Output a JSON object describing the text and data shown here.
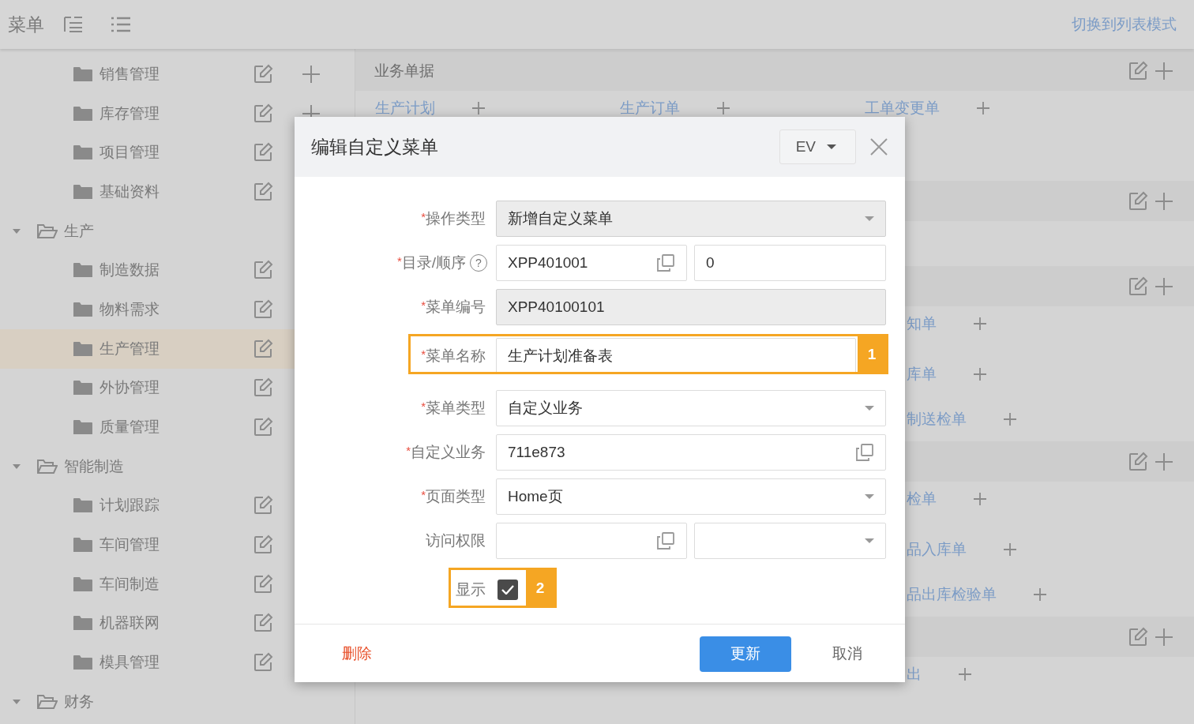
{
  "header": {
    "title": "菜单",
    "switch_link": "切换到列表模式"
  },
  "sidebar": {
    "items_above": [
      {
        "label": "销售管理",
        "selected": false,
        "add_button": true
      },
      {
        "label": "库存管理",
        "selected": false,
        "add_button": true
      },
      {
        "label": "项目管理",
        "selected": false,
        "add_button": false
      },
      {
        "label": "基础资料",
        "selected": false,
        "add_button": false
      }
    ],
    "groups": [
      {
        "label": "生产",
        "expanded": true,
        "children": [
          {
            "label": "制造数据",
            "selected": false,
            "add_button": false
          },
          {
            "label": "物料需求",
            "selected": false,
            "add_button": false
          },
          {
            "label": "生产管理",
            "selected": true,
            "add_button": false
          },
          {
            "label": "外协管理",
            "selected": false,
            "add_button": false
          },
          {
            "label": "质量管理",
            "selected": false,
            "add_button": false
          }
        ]
      },
      {
        "label": "智能制造",
        "expanded": true,
        "children": [
          {
            "label": "计划跟踪",
            "selected": false,
            "add_button": false
          },
          {
            "label": "车间管理",
            "selected": false,
            "add_button": false
          },
          {
            "label": "车间制造",
            "selected": false,
            "add_button": false
          },
          {
            "label": "机器联网",
            "selected": false,
            "add_button": false
          },
          {
            "label": "模具管理",
            "selected": false,
            "add_button": false
          }
        ]
      },
      {
        "label": "财务",
        "expanded": true
      }
    ]
  },
  "sections": [
    {
      "kind": "header",
      "title": "业务单据",
      "rows": [
        {
          "cells": [
            "生产计划",
            "生产订单",
            "工单变更单"
          ],
          "third_clipped": false
        }
      ]
    },
    {
      "kind": "header"
    },
    {
      "kind": "header",
      "rows": [
        {
          "cells": [
            "",
            "",
            "知单"
          ],
          "third_clipped": true
        },
        {
          "cells": [
            "",
            "",
            "库单"
          ],
          "third_clipped": true
        },
        {
          "cells": [
            "",
            "",
            "制送检单"
          ],
          "third_clipped": true
        }
      ]
    },
    {
      "kind": "header",
      "rows": [
        {
          "cells": [
            "",
            "",
            "检单"
          ],
          "third_clipped": true
        },
        {
          "cells": [
            "",
            "",
            "品入库单"
          ],
          "third_clipped": true
        },
        {
          "cells": [
            "",
            "",
            "品出库检验单"
          ],
          "third_clipped": true
        }
      ]
    },
    {
      "kind": "header",
      "rows": [
        {
          "cells": [
            "",
            "",
            "出"
          ],
          "third_clipped": true
        }
      ]
    }
  ],
  "dialog": {
    "title": "编辑自定义菜单",
    "language": "EV",
    "rows": [
      {
        "kind": "fields",
        "marker": "*",
        "label": "操作类型",
        "inputs": [
          {
            "kind": "select",
            "value": "新增自定义菜单",
            "readonly": true
          }
        ]
      },
      {
        "kind": "fields",
        "marker": "*",
        "label": "目录/顺序",
        "help": "?",
        "inputs": [
          {
            "kind": "copy",
            "value": "XPP401001",
            "readonly": false
          },
          {
            "kind": "text",
            "value": "0",
            "readonly": false
          }
        ]
      },
      {
        "kind": "fields",
        "marker": "*",
        "label": "菜单编号",
        "inputs": [
          {
            "kind": "text",
            "value": "XPP40100101",
            "readonly": true
          }
        ]
      },
      {
        "kind": "fields",
        "marker": "*",
        "label": "菜单名称",
        "callout": "1",
        "inputs": [
          {
            "kind": "text",
            "value": "生产计划准备表",
            "readonly": false
          }
        ]
      },
      {
        "kind": "fields",
        "marker": "*",
        "label": "菜单类型",
        "inputs": [
          {
            "kind": "select",
            "value": "自定义业务",
            "readonly": false
          }
        ]
      },
      {
        "kind": "fields",
        "marker": "*",
        "label": "自定义业务",
        "inputs": [
          {
            "kind": "copy",
            "value": "711e873",
            "readonly": false
          }
        ]
      },
      {
        "kind": "fields",
        "marker": "*",
        "label": "页面类型",
        "inputs": [
          {
            "kind": "select",
            "value": "Home页",
            "readonly": false
          }
        ]
      },
      {
        "kind": "fields",
        "label": "访问权限",
        "inputs": [
          {
            "kind": "copy",
            "readonly": false
          },
          {
            "kind": "select",
            "readonly": false
          }
        ]
      },
      {
        "kind": "checkbox",
        "label": "显示",
        "checked": true,
        "callout": "2"
      }
    ],
    "delete_button": "删除",
    "update_button": "更新",
    "cancel_button": "取消"
  }
}
